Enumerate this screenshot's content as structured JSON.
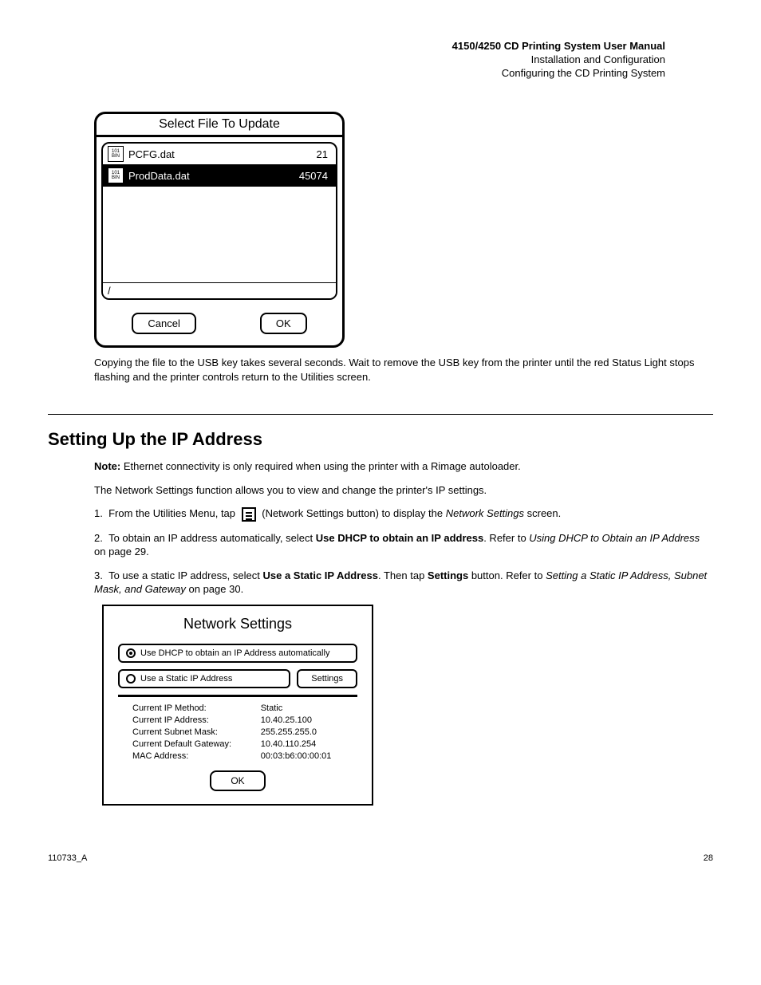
{
  "header": {
    "manual_title": "4150/4250 CD Printing System User Manual",
    "section_path": "Installation and Configuration",
    "subsection": "Configuring the CD Printing System"
  },
  "file_dialog": {
    "title": "Select File To Update",
    "files": [
      {
        "name": "PCFG.dat",
        "size": "21",
        "selected": false
      },
      {
        "name": "ProdData.dat",
        "size": "45074",
        "selected": true
      }
    ],
    "path": "/",
    "cancel_label": "Cancel",
    "ok_label": "OK"
  },
  "copy_note": "Copying the file to the USB key takes several seconds. Wait to remove the USB key from the printer until the red Status Light stops flashing and the printer controls return to the Utilities screen.",
  "section": {
    "heading": "Setting Up the IP Address",
    "intro_before_note": "Note:",
    "intro_note": "Ethernet connectivity is only required when using the printer with a Rimage autoloader.",
    "para2": "The Network Settings function allows you to view and change the printer's IP settings.",
    "steps": [
      "From the Utilities Menu, tap       (Network Settings button) to display the Network Settings screen.",
      "To obtain an IP address automatically, select Use DHCP to obtain an IP address. Refer to Using DHCP to Obtain an IP Address on page 29.",
      "To use a static IP address, select Use a Static IP Address. Then tap Settings button. Refer to Setting a Static IP Address, Subnet Mask, and Gateway on page 30."
    ],
    "italic_refs": {
      "ref1": "Using DHCP to Obtain an IP Address",
      "ref2": "Setting a Static IP Address, Subnet Mask, and Gateway"
    }
  },
  "network_dialog": {
    "title": "Network Settings",
    "dhcp_label": "Use DHCP to obtain an IP Address automatically",
    "static_label": "Use a Static IP Address",
    "settings_btn": "Settings",
    "rows": [
      {
        "label": "Current IP Method:",
        "value": "Static"
      },
      {
        "label": "Current IP Address:",
        "value": "10.40.25.100"
      },
      {
        "label": "Current Subnet Mask:",
        "value": "255.255.255.0"
      },
      {
        "label": "Current Default Gateway:",
        "value": "10.40.110.254"
      },
      {
        "label": "MAC Address:",
        "value": "00:03:b6:00:00:01"
      }
    ],
    "ok_label": "OK"
  },
  "footer": {
    "docnum": "110733_A",
    "page": "28"
  }
}
